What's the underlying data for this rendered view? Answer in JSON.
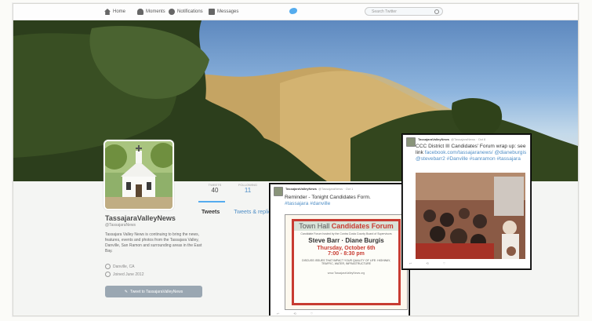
{
  "nav": {
    "home": "Home",
    "notifications": "Moments",
    "moments": "Notifications",
    "messages": "Messages",
    "search_placeholder": "Search Twitter"
  },
  "profile": {
    "name": "TassajaraValleyNews",
    "handle": "@TassajaraNews",
    "bio": "Tassajara Valley News is continuing to bring the news, features, events and photos from the Tassajara Valley, Danville, San Ramon and surrounding areas in the East Bay.",
    "location": "Danville, CA",
    "joined": "Joined June 2012",
    "tweet_button": "Tweet to TassajaraValleyNews"
  },
  "stats": [
    {
      "label": "TWEETS",
      "value": "40"
    },
    {
      "label": "FOLLOWING",
      "value": "11"
    }
  ],
  "tabs": [
    "Tweets",
    "Tweets & replies"
  ],
  "card1": {
    "user": "TassajaraValleyNews",
    "handle": "@TassajaraNews · Oct 1",
    "text": "Reminder - Tonight Candidates Form.",
    "tags": "#tassajara #danville",
    "flyer": {
      "title_prefix": "Town Hall ",
      "title_highlight": "Candidates Forum",
      "subtitle": "Candidate Forum hosted by the Contra Costa County Board of Supervisors",
      "candidates": "Steve Barr · Diane Burgis",
      "date": "Thursday, October 6th",
      "time": "7:00 - 8:30 pm",
      "topics": "DISCUSS ISSUES THAT IMPACT YOUR QUALITY OF LIFE: HIGHWAY, TRAFFIC, WATER, INFRASTRUCTURE",
      "footer": "www.TassajaraValleyNews.org"
    }
  },
  "card2": {
    "user": "TassajaraValleyNews",
    "handle": "@TassajaraNews · Oct 8",
    "text": "CCC District III Candidates' Forum wrap up: see link ",
    "link": "facebook.com/tassajaranews/",
    "tags": "@dianeburgis @stevebarr2 #Danville #sanramon #tassajara"
  },
  "colors": {
    "accent": "#55acee",
    "flyer_red": "#c83c32"
  }
}
